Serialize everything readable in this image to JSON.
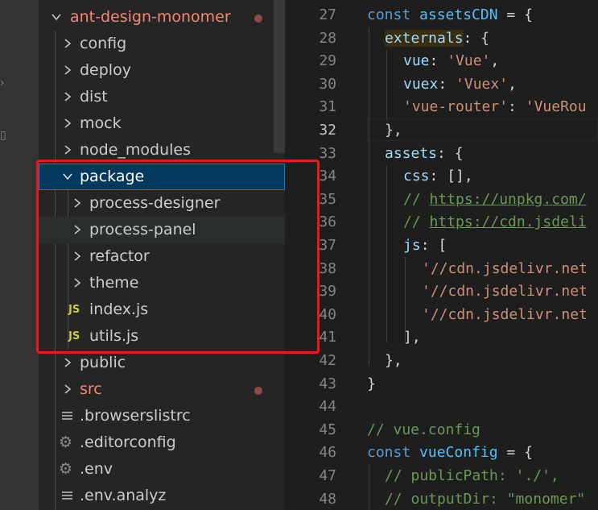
{
  "explorer": {
    "root": {
      "label": "ant-design-monomer",
      "modified": true
    },
    "items": [
      {
        "label": "config",
        "type": "folder",
        "collapsed": true
      },
      {
        "label": "deploy",
        "type": "folder",
        "collapsed": true
      },
      {
        "label": "dist",
        "type": "folder",
        "collapsed": true
      },
      {
        "label": "mock",
        "type": "folder",
        "collapsed": true
      },
      {
        "label": "node_modules",
        "type": "folder",
        "collapsed": true
      },
      {
        "label": "package",
        "type": "folder",
        "collapsed": false,
        "selected": true
      },
      {
        "label": "process-designer",
        "type": "folder",
        "collapsed": true
      },
      {
        "label": "process-panel",
        "type": "folder",
        "collapsed": true
      },
      {
        "label": "refactor",
        "type": "folder",
        "collapsed": true
      },
      {
        "label": "theme",
        "type": "folder",
        "collapsed": true
      },
      {
        "label": "index.js",
        "type": "js"
      },
      {
        "label": "utils.js",
        "type": "js"
      },
      {
        "label": "public",
        "type": "folder",
        "collapsed": true
      },
      {
        "label": "src",
        "type": "folder",
        "collapsed": true,
        "modified": true
      },
      {
        "label": ".browserslistrc",
        "type": "config"
      },
      {
        "label": ".editorconfig",
        "type": "settings"
      },
      {
        "label": ".env",
        "type": "settings"
      },
      {
        "label": ".env.analyz",
        "type": "config"
      }
    ],
    "js_badge": "JS"
  },
  "editor": {
    "line_numbers": [
      "27",
      "28",
      "29",
      "30",
      "31",
      "32",
      "33",
      "34",
      "35",
      "36",
      "37",
      "38",
      "39",
      "40",
      "41",
      "42",
      "43",
      "44",
      "45",
      "46",
      "47",
      "48"
    ],
    "active_line": "32",
    "tokens": {
      "l27": [
        "const",
        " ",
        "assetsCDN",
        " = {"
      ],
      "l28": [
        "externals",
        ": {"
      ],
      "l29": [
        "vue",
        ": ",
        "'Vue'",
        ","
      ],
      "l30": [
        "vuex",
        ": ",
        "'Vuex'",
        ","
      ],
      "l31": [
        "'vue-router'",
        ": ",
        "'VueRou"
      ],
      "l32": [
        "},"
      ],
      "l33": [
        "assets",
        ": {"
      ],
      "l34": [
        "css",
        ": [],"
      ],
      "l35": [
        "// ",
        "https://unpkg.com/"
      ],
      "l36": [
        "// ",
        "https://cdn.jsdeli"
      ],
      "l37": [
        "js",
        ": ["
      ],
      "l38": [
        "'//cdn.jsdelivr.net"
      ],
      "l39": [
        "'//cdn.jsdelivr.net"
      ],
      "l40": [
        "'//cdn.jsdelivr.net"
      ],
      "l41": [
        "],"
      ],
      "l42": [
        "},"
      ],
      "l43": [
        "}"
      ],
      "l44": [
        ""
      ],
      "l45": [
        "// vue.config"
      ],
      "l46": [
        "const",
        " ",
        "vueConfig",
        " = {"
      ],
      "l47": [
        "// publicPath: './',"
      ],
      "l48": [
        "// outputDir: \"monomer\""
      ]
    }
  },
  "colors": {
    "root_label": "#f48771",
    "modified_label": "#f48771",
    "selection_bg": "#04395e",
    "annotation_box": "#e81a1a"
  }
}
